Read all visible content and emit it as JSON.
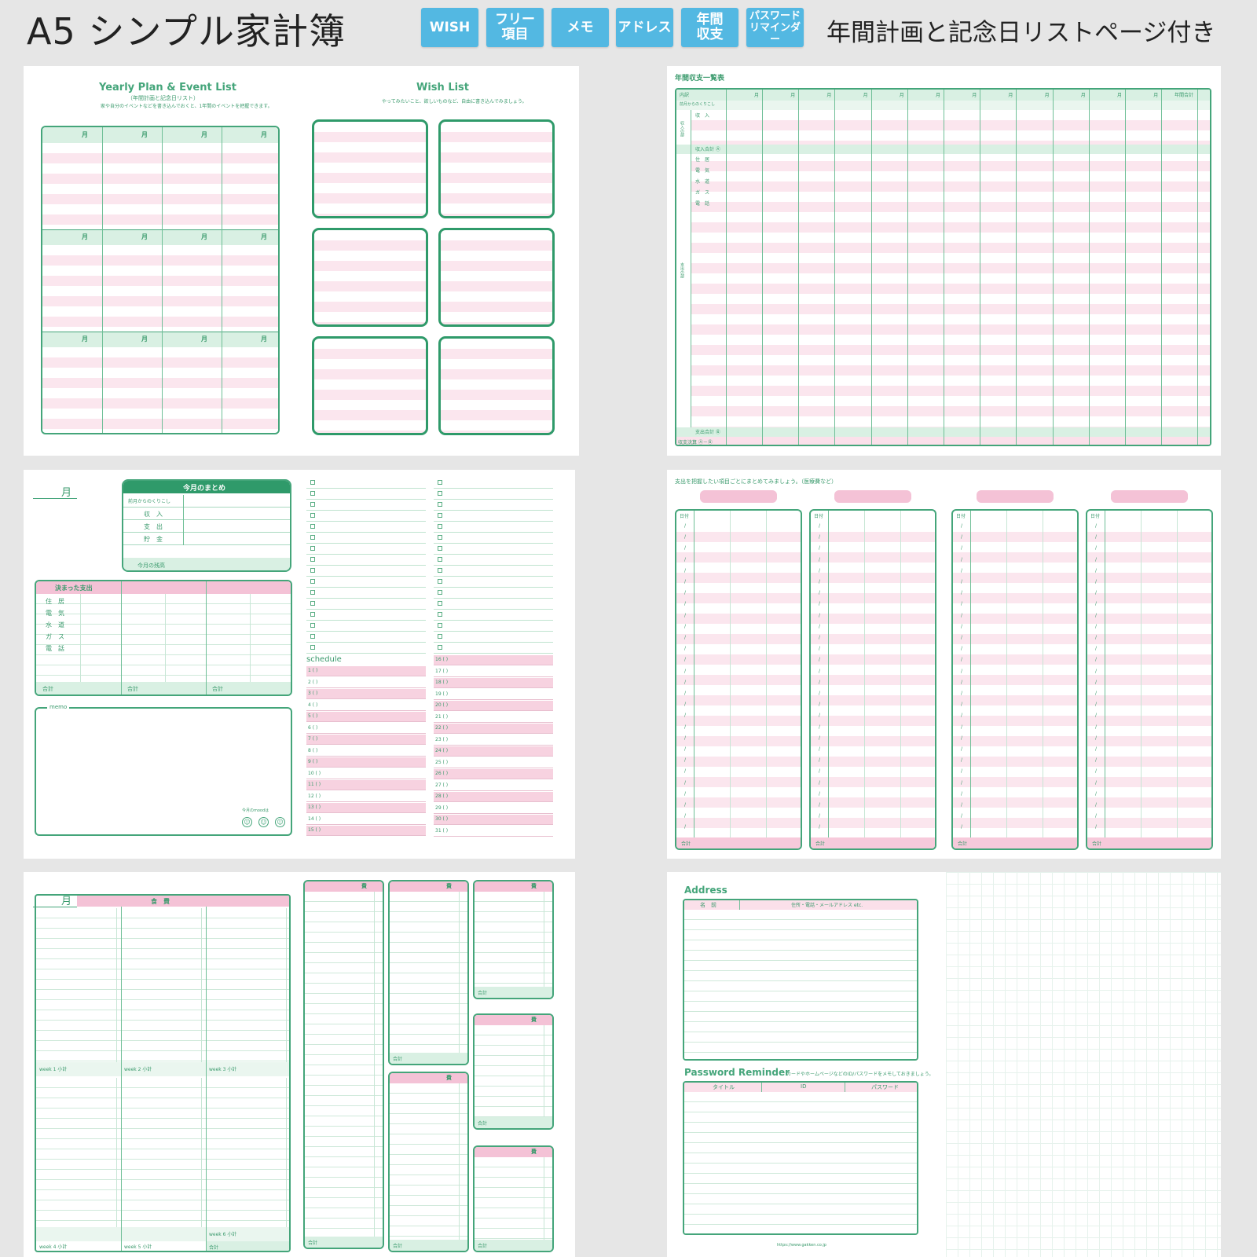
{
  "header": {
    "title": "A5 シンプル家計簿",
    "tags": [
      "WISH",
      "フリー\n項目",
      "メモ",
      "アドレス",
      "年間\n収支",
      "パスワード\nリマインダー"
    ],
    "subtitle": "年間計画と記念日リストページ付き"
  },
  "yearly": {
    "title": "Yearly Plan & Event List",
    "sub1": "（年間計画と記念日リスト）",
    "sub2": "家や自分のイベントなどを書き込んでおくと、1年間のイベントを把握できます。",
    "month": "月",
    "wish_title": "Wish List",
    "wish_sub": "やってみたいこと、欲しいものなど、自由に書き込んでみましょう。"
  },
  "annual": {
    "title": "年間収支一覧表",
    "month": "月",
    "head_left": "内訳",
    "head_right": "年間合計",
    "carry": "前月からのくりこし",
    "income": "収　入",
    "income_side": "収入の部",
    "income_total": "収入合計 Ⓐ",
    "expense_items": [
      "住　居",
      "電　気",
      "水　道",
      "ガ　ス",
      "電　話"
    ],
    "expense_side": "支出の部",
    "expense_total": "支出合計 Ⓑ",
    "balance": "収支決算 Ⓐ－Ⓑ"
  },
  "monthly": {
    "month": "月",
    "summary_title": "今月のまとめ",
    "summary_rows": [
      "前月からのくりこし",
      "収　入",
      "支　出",
      "貯　金"
    ],
    "balance": "今月の残高",
    "fixed_title": "決まった支出",
    "fixed_items": [
      "住　居",
      "電　気",
      "水　道",
      "ガ　ス",
      "電　話"
    ],
    "total": "合計",
    "memo": "memo",
    "mood": "今月のmoodは",
    "smileys": [
      "☺",
      "☺",
      "☺"
    ],
    "schedule": "schedule",
    "days_left": [
      "1 (  )",
      "2 (  )",
      "3 (  )",
      "4 (  )",
      "5 (  )",
      "6 (  )",
      "7 (  )",
      "8 (  )",
      "9 (  )",
      "10 (  )",
      "11 (  )",
      "12 (  )",
      "13 (  )",
      "14 (  )",
      "15 (  )"
    ],
    "days_right": [
      "16 (  )",
      "17 (  )",
      "18 (  )",
      "19 (  )",
      "20 (  )",
      "21 (  )",
      "22 (  )",
      "23 (  )",
      "24 (  )",
      "25 (  )",
      "26 (  )",
      "27 (  )",
      "28 (  )",
      "29 (  )",
      "30 (  )",
      "31 (  )"
    ]
  },
  "categories": {
    "note": "支出を把握したい項目ごとにまとめてみましょう。（医療費など）",
    "date": "日付",
    "slash": "/",
    "total": "合計"
  },
  "food": {
    "month": "月",
    "title": "食　費",
    "weeks": [
      "week 1 小計",
      "week 2 小計",
      "week 3 小計",
      "week 4 小計",
      "week 5 小計",
      "week 6 小計"
    ],
    "total": "合計",
    "cost": "費"
  },
  "address": {
    "title": "Address",
    "col_name": "名　前",
    "col_info": "住所・電話・メールアドレス etc.",
    "pw_title": "Password Reminder",
    "pw_note": "カードやホームページなどのID/パスワードをメモしておきましょう。",
    "pw_cols": [
      "タイトル",
      "ID",
      "パスワード"
    ],
    "footer": "https://www.gakken.co.jp"
  },
  "colors": {
    "green": "#44a57a",
    "pink": "#f4c2d6",
    "lightpink": "#fbe6ee",
    "tag": "#53b8e2"
  }
}
